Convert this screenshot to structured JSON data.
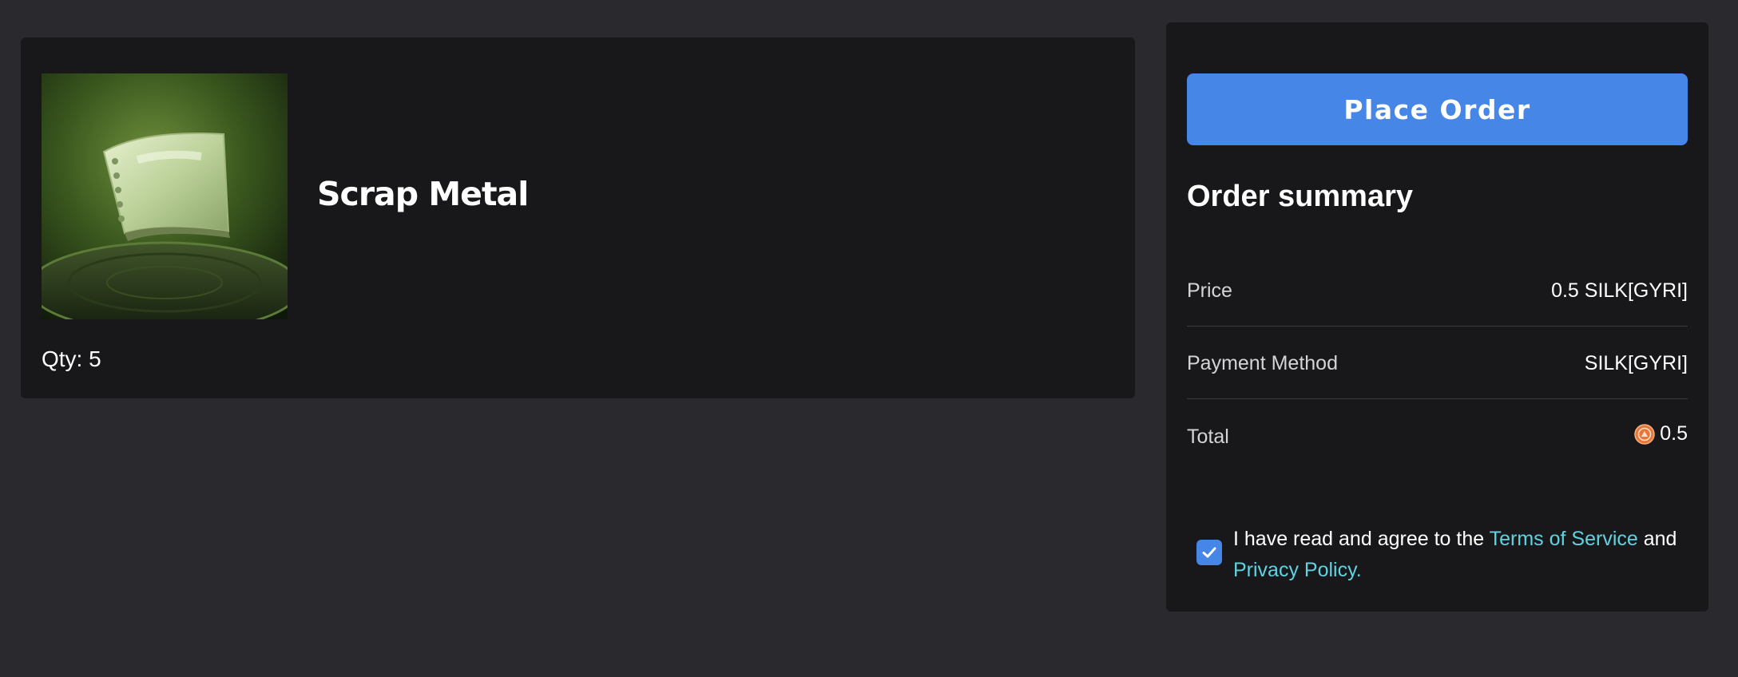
{
  "item": {
    "name": "Scrap Metal",
    "qty_text": "Qty: 5"
  },
  "summary": {
    "place_order_label": "Place Order",
    "title": "Order summary",
    "rows": [
      {
        "label": "Price",
        "value": "0.5 SILK[GYRI]"
      },
      {
        "label": "Payment Method",
        "value": "SILK[GYRI]"
      },
      {
        "label": "Total",
        "value": "0.5",
        "icon": "silk-coin-icon"
      }
    ]
  },
  "agreement": {
    "checked": true,
    "prefix": "I have read and agree to the ",
    "terms_link": "Terms of Service",
    "middle": " and ",
    "privacy_link": "Privacy Policy."
  },
  "colors": {
    "page_bg": "#2a292e",
    "card_bg": "#18181b",
    "accent": "#4686e6",
    "link": "#5fd3e0",
    "coin": "#e8763a"
  }
}
